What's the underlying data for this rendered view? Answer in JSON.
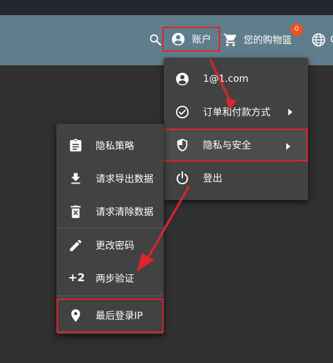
{
  "header": {
    "account_label": "账户",
    "cart_label": "您的购物篮",
    "cart_count": "0",
    "language_label": "C"
  },
  "icons": {
    "search": "search-icon",
    "account": "account-circle-icon",
    "cart": "shopping-cart-icon",
    "globe": "globe-icon",
    "check_circle": "check-circle-icon",
    "shield": "shield-icon",
    "power": "power-icon",
    "clipboard": "clipboard-icon",
    "download": "download-icon",
    "delete": "delete-icon",
    "pencil": "pencil-icon",
    "location": "location-pin-icon"
  },
  "account_menu": {
    "email": "1@1.com",
    "orders_payment": "订单和付款方式",
    "privacy_security": "隐私与安全",
    "logout": "登出"
  },
  "privacy_menu": {
    "privacy_policy": "隐私策略",
    "request_export": "请求导出数据",
    "request_delete": "请求清除数据",
    "change_password": "更改密码",
    "two_step_badge": "+2",
    "two_step": "两步验证",
    "last_login_ip": "最后登录IP"
  },
  "colors": {
    "header_bg": "#607d8b",
    "page_bg": "#303030",
    "menu_bg": "#424242",
    "highlight_red": "#e0242b",
    "badge_orange": "#f4511e"
  }
}
